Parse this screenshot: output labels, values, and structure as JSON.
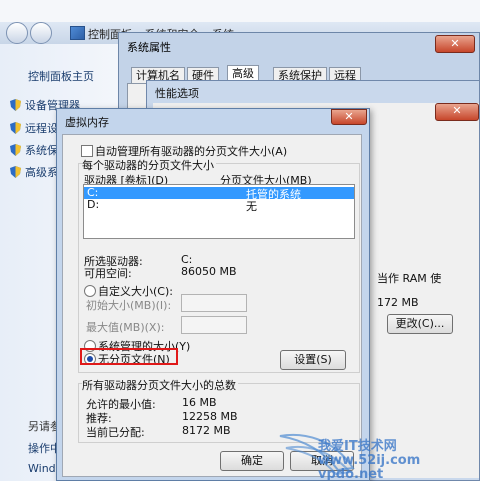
{
  "control_panel": {
    "nav_path": "控制面板 ▸ 系统和安全 ▸ 系统",
    "home_link": "控制面板主页",
    "items": [
      "设备管理器",
      "远程设",
      "系统保",
      "高级系"
    ],
    "also_see": "另请参",
    "action_center": "操作中",
    "windows_update": "Windo"
  },
  "system_properties": {
    "title": "系统属性",
    "close_label": "✕",
    "tabs": [
      "计算机名",
      "硬件",
      "高级",
      "系统保护",
      "远程"
    ]
  },
  "performance_options": {
    "title": "性能选项",
    "ram_text": "当作 RAM 使",
    "mb_text": "172 MB",
    "change_button": "更改(C)...",
    "close_label": "✕"
  },
  "virtual_memory": {
    "title": "虚拟内存",
    "close_label": "✕",
    "auto_manage_label": "自动管理所有驱动器的分页文件大小(A)",
    "per_drive_header": "每个驱动器的分页文件大小",
    "col_drive": "驱动器 [卷标](D)",
    "col_size": "分页文件大小(MB)",
    "drives": [
      {
        "drive": "C:",
        "size": "托管的系统"
      },
      {
        "drive": "D:",
        "size": "无"
      }
    ],
    "selected_drive_label": "所选驱动器:",
    "selected_drive_value": "C:",
    "free_space_label": "可用空间:",
    "free_space_value": "86050 MB",
    "custom_size_label": "自定义大小(C):",
    "initial_size_label": "初始大小(MB)(I):",
    "max_size_label": "最大值(MB)(X):",
    "system_managed_label": "系统管理的大小(Y)",
    "no_paging_label": "无分页文件(N)",
    "set_button": "设置(S)",
    "total_header": "所有驱动器分页文件大小的总数",
    "min_allowed_label": "允许的最小值:",
    "min_allowed_value": "16 MB",
    "recommended_label": "推荐:",
    "recommended_value": "12258 MB",
    "current_label": "当前已分配:",
    "current_value": "8172 MB",
    "ok_button": "确定",
    "cancel_button": "取消"
  },
  "watermark": "我爱IT技术网 www.52ij.com vpdo.net"
}
